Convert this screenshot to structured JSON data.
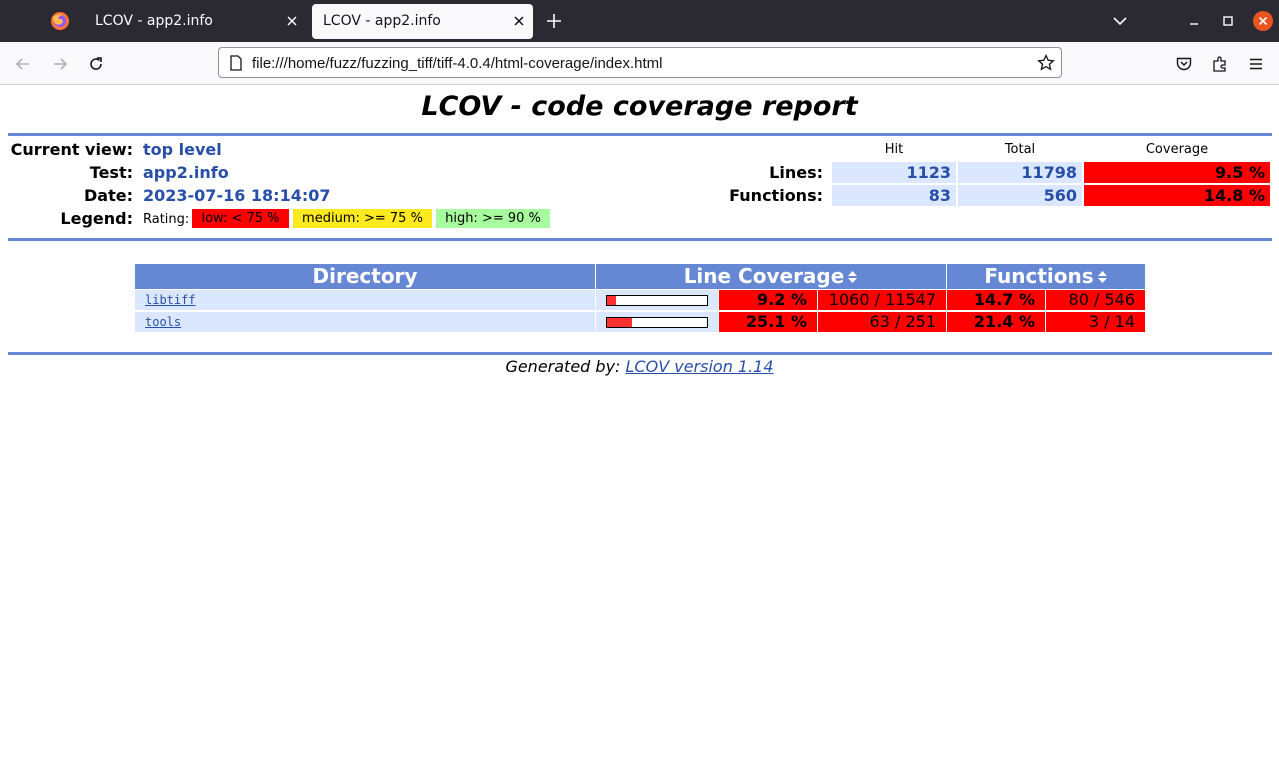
{
  "browser": {
    "tabs": [
      {
        "title": "LCOV - app2.info",
        "active": false
      },
      {
        "title": "LCOV - app2.info",
        "active": true
      }
    ],
    "url": "file:///home/fuzz/fuzzing_tiff/tiff-4.0.4/html-coverage/index.html",
    "icons": [
      "firefox-logo",
      "close-icon",
      "plus-icon",
      "chevron-down-icon",
      "minimize-icon",
      "maximize-icon",
      "window-close-icon",
      "back-arrow-icon",
      "forward-arrow-icon",
      "reload-icon",
      "page-icon",
      "star-icon",
      "pocket-icon",
      "extensions-icon",
      "menu-icon"
    ],
    "accent_close": "#e95420"
  },
  "report": {
    "title": "LCOV - code coverage report",
    "header": {
      "current_view_label": "Current view:",
      "current_view_value": "top level",
      "test_label": "Test:",
      "test_value": "app2.info",
      "date_label": "Date:",
      "date_value": "2023-07-16 18:14:07",
      "legend_label": "Legend:",
      "rating_label": "Rating:",
      "legend_low": "low: < 75 %",
      "legend_medium": "medium: >= 75 %",
      "legend_high": "high: >= 90 %"
    },
    "summary": {
      "col_hit": "Hit",
      "col_total": "Total",
      "col_coverage": "Coverage",
      "lines_label": "Lines:",
      "lines_hit": "1123",
      "lines_total": "11798",
      "lines_coverage": "9.5 %",
      "functions_label": "Functions:",
      "functions_hit": "83",
      "functions_total": "560",
      "functions_coverage": "14.8 %"
    },
    "table": {
      "col_directory": "Directory",
      "col_line_coverage": "Line Coverage",
      "col_functions": "Functions",
      "rows": [
        {
          "name": "libtiff",
          "line_pct": "9.2 %",
          "line_ratio": "1060 / 11547",
          "func_pct": "14.7 %",
          "func_ratio": "80 / 546",
          "bar_fraction": 0.092
        },
        {
          "name": "tools",
          "line_pct": "25.1 %",
          "line_ratio": "63 / 251",
          "func_pct": "21.4 %",
          "func_ratio": "3 / 14",
          "bar_fraction": 0.251
        }
      ]
    },
    "footer": {
      "generated_by": "Generated by:",
      "link_text": "LCOV version 1.14"
    },
    "colors": {
      "rule": "#6688d4",
      "value_bg": "#dae7fe",
      "low": "#ff0000",
      "medium": "#ffea20",
      "high": "#a7fc9d",
      "link": "#284fa8"
    }
  }
}
